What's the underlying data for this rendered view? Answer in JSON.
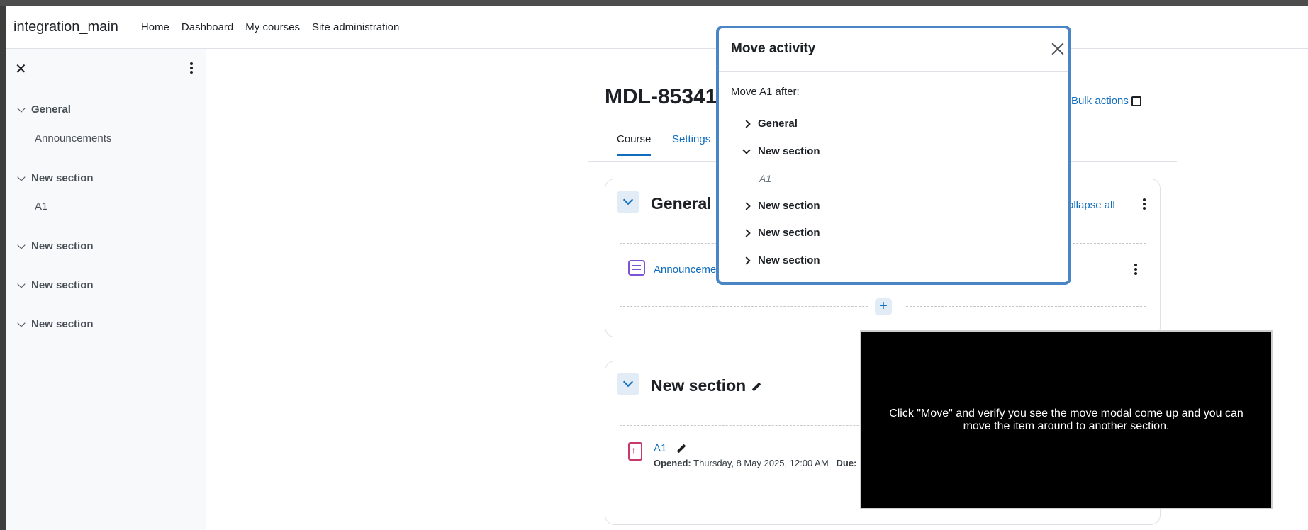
{
  "navbar": {
    "brand": "integration_main",
    "links": [
      "Home",
      "Dashboard",
      "My courses",
      "Site administration"
    ]
  },
  "course_index": {
    "close_icon": "close-icon",
    "menu_icon": "kebab-icon",
    "sections": [
      {
        "title": "General",
        "items": [
          "Announcements"
        ]
      },
      {
        "title": "New section",
        "items": [
          "A1"
        ]
      },
      {
        "title": "New section",
        "items": []
      },
      {
        "title": "New section",
        "items": []
      },
      {
        "title": "New section",
        "items": []
      }
    ]
  },
  "page": {
    "title": "MDL-85341",
    "bulk_actions": "Bulk actions",
    "tabs": [
      "Course",
      "Settings"
    ],
    "general_section": {
      "title": "General",
      "collapse_all": "ollapse all",
      "activity": "Announceme"
    },
    "new_section": {
      "title": "New section",
      "activity": "A1",
      "opened_label": "Opened:",
      "opened_value": "Thursday, 8 May 2025, 12:00 AM",
      "due_label": "Due:"
    }
  },
  "modal": {
    "title": "Move activity",
    "label": "Move A1 after:",
    "items": [
      "General",
      "New section",
      "New section",
      "New section",
      "New section"
    ],
    "nested_activity": "A1"
  },
  "overlay": {
    "text": "Click \"Move\" and verify you see the move modal come up and you can move the item around to another section."
  },
  "colors": {
    "link": "#0f6cbf",
    "modal_border": "#4a86c5"
  }
}
